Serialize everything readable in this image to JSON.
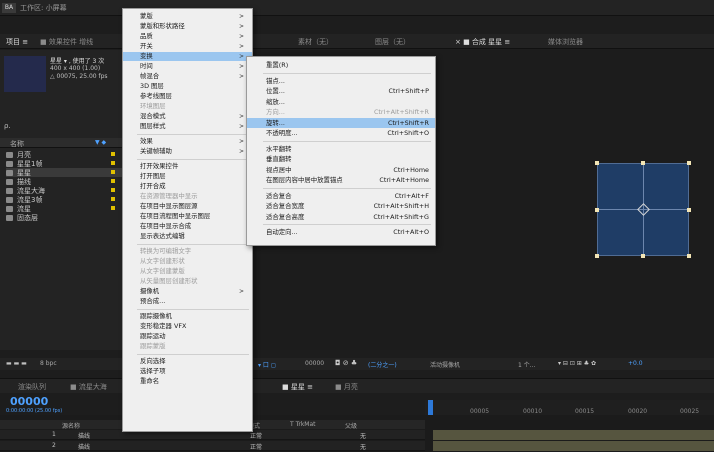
{
  "workspace": {
    "badge": "BA",
    "label": "工作区: 小屏幕"
  },
  "panel_tabs": {
    "project": "项目 ≡",
    "effects": "■ 效果控件 增线",
    "material": "素材（无）",
    "layer": "图层（无）",
    "composition": "× ■ 合成 星星 ≡",
    "render": "媒体浏览器"
  },
  "project": {
    "comp_name": "星星 ▾ , 使用了 3 次",
    "comp_size": "400 x 400 (1.00)",
    "comp_duration": "△ 00075, 25.00 fps",
    "search_icon_label": "ρ.",
    "col_name": "名称",
    "items": [
      {
        "label": "月亮",
        "selected": false
      },
      {
        "label": "星星1帧",
        "selected": false
      },
      {
        "label": "星星",
        "selected": true
      },
      {
        "label": "描线",
        "selected": false
      },
      {
        "label": "流星大海",
        "selected": false
      },
      {
        "label": "流星3帧",
        "selected": false
      },
      {
        "label": "流星",
        "selected": false
      },
      {
        "label": "固态层",
        "selected": false
      }
    ]
  },
  "context_menu": {
    "items": [
      {
        "label": "蒙版",
        "arrow": true,
        "disabled": false
      },
      {
        "label": "蒙版和形状路径",
        "arrow": true,
        "disabled": false
      },
      {
        "label": "品质",
        "arrow": true,
        "disabled": false
      },
      {
        "label": "开关",
        "arrow": true,
        "disabled": false
      },
      {
        "label": "变换",
        "arrow": true,
        "disabled": false,
        "highlight": true
      },
      {
        "label": "时间",
        "arrow": true,
        "disabled": false
      },
      {
        "label": "帧混合",
        "arrow": true,
        "disabled": false
      },
      {
        "label": "3D 图层",
        "arrow": false,
        "disabled": false
      },
      {
        "label": "参考线图层",
        "arrow": false,
        "disabled": false
      },
      {
        "label": "环境图层",
        "arrow": false,
        "disabled": true
      },
      {
        "label": "混合模式",
        "arrow": true,
        "disabled": false
      },
      {
        "label": "图层样式",
        "arrow": true,
        "disabled": false
      },
      {
        "sep": true
      },
      {
        "label": "效果",
        "arrow": true,
        "disabled": false
      },
      {
        "label": "关键帧辅助",
        "arrow": true,
        "disabled": false
      },
      {
        "sep": true
      },
      {
        "label": "打开效果控件",
        "arrow": false,
        "disabled": false
      },
      {
        "label": "打开图层",
        "arrow": false,
        "disabled": false
      },
      {
        "label": "打开合成",
        "arrow": false,
        "disabled": false
      },
      {
        "label": "在资源管理器中显示",
        "arrow": false,
        "disabled": true
      },
      {
        "label": "在项目中显示图层源",
        "arrow": false,
        "disabled": false
      },
      {
        "label": "在项目流程图中显示图层",
        "arrow": false,
        "disabled": false
      },
      {
        "label": "在项目中显示合成",
        "arrow": false,
        "disabled": false
      },
      {
        "label": "显示表达式编辑",
        "arrow": false,
        "disabled": false
      },
      {
        "sep": true
      },
      {
        "label": "转换为可编辑文字",
        "arrow": false,
        "disabled": true
      },
      {
        "label": "从文字创建形状",
        "arrow": false,
        "disabled": true
      },
      {
        "label": "从文字创建蒙版",
        "arrow": false,
        "disabled": true
      },
      {
        "label": "从矢量图层创建形状",
        "arrow": false,
        "disabled": true
      },
      {
        "label": "摄像机",
        "arrow": true,
        "disabled": false
      },
      {
        "label": "预合成...",
        "arrow": false,
        "disabled": false
      },
      {
        "sep": true
      },
      {
        "label": "跟踪摄像机",
        "arrow": false,
        "disabled": false
      },
      {
        "label": "变形稳定器 VFX",
        "arrow": false,
        "disabled": false
      },
      {
        "label": "跟踪运动",
        "arrow": false,
        "disabled": false
      },
      {
        "label": "跟踪蒙版",
        "arrow": false,
        "disabled": true
      },
      {
        "sep": true
      },
      {
        "label": "反向选择",
        "arrow": false,
        "disabled": false
      },
      {
        "label": "选择子项",
        "arrow": false,
        "disabled": false
      },
      {
        "label": "重命名",
        "arrow": false,
        "disabled": false
      }
    ]
  },
  "submenu": {
    "items": [
      {
        "label": "重置(R)",
        "shortcut": "",
        "disabled": false
      },
      {
        "sep": true
      },
      {
        "label": "锚点...",
        "shortcut": "",
        "disabled": false
      },
      {
        "label": "位置...",
        "shortcut": "Ctrl+Shift+P",
        "disabled": false
      },
      {
        "label": "缩放...",
        "shortcut": "",
        "disabled": false
      },
      {
        "label": "方向...",
        "shortcut": "Ctrl+Alt+Shift+R",
        "disabled": true
      },
      {
        "label": "旋转...",
        "shortcut": "Ctrl+Shift+R",
        "disabled": false,
        "highlight": true
      },
      {
        "label": "不透明度...",
        "shortcut": "Ctrl+Shift+O",
        "disabled": false
      },
      {
        "sep": true
      },
      {
        "label": "水平翻转",
        "shortcut": "",
        "disabled": false
      },
      {
        "label": "垂直翻转",
        "shortcut": "",
        "disabled": false
      },
      {
        "label": "视点居中",
        "shortcut": "Ctrl+Home",
        "disabled": false
      },
      {
        "label": "在图层内容中居中放置锚点",
        "shortcut": "Ctrl+Alt+Home",
        "disabled": false
      },
      {
        "sep": true
      },
      {
        "label": "适合复合",
        "shortcut": "Ctrl+Alt+F",
        "disabled": false
      },
      {
        "label": "适合复合宽度",
        "shortcut": "Ctrl+Alt+Shift+H",
        "disabled": false
      },
      {
        "label": "适合复合高度",
        "shortcut": "Ctrl+Alt+Shift+G",
        "disabled": false
      },
      {
        "sep": true
      },
      {
        "label": "自动定向...",
        "shortcut": "Ctrl+Alt+O",
        "disabled": false
      }
    ]
  },
  "viewer_toolbar": {
    "bit_depth": "8 bpc",
    "frame": "00000",
    "resolution": "(二分之一)",
    "camera": "活动摄像机",
    "views": "1 个...",
    "exposure": "+0.0"
  },
  "timeline": {
    "tab_render": "渲染队列",
    "tab_star_wave": "■ 流星大海",
    "tab_stars": "■ 星星 ≡",
    "tab_moon": "■ 月亮",
    "timecode": "00000",
    "timecode_sub": "0:00:00:00 (25.00 fps)",
    "col_source": "源名称",
    "col_mode": "模式",
    "col_trkmat": "T TrkMat",
    "col_parent": "父级",
    "ticks": [
      "00005",
      "00010",
      "00015",
      "00020",
      "00025"
    ],
    "layers": [
      {
        "index": "1",
        "name": "描线",
        "mode": "正常",
        "parent": "无"
      },
      {
        "index": "2",
        "name": "描线",
        "mode": "正常",
        "parent": "无"
      }
    ]
  }
}
